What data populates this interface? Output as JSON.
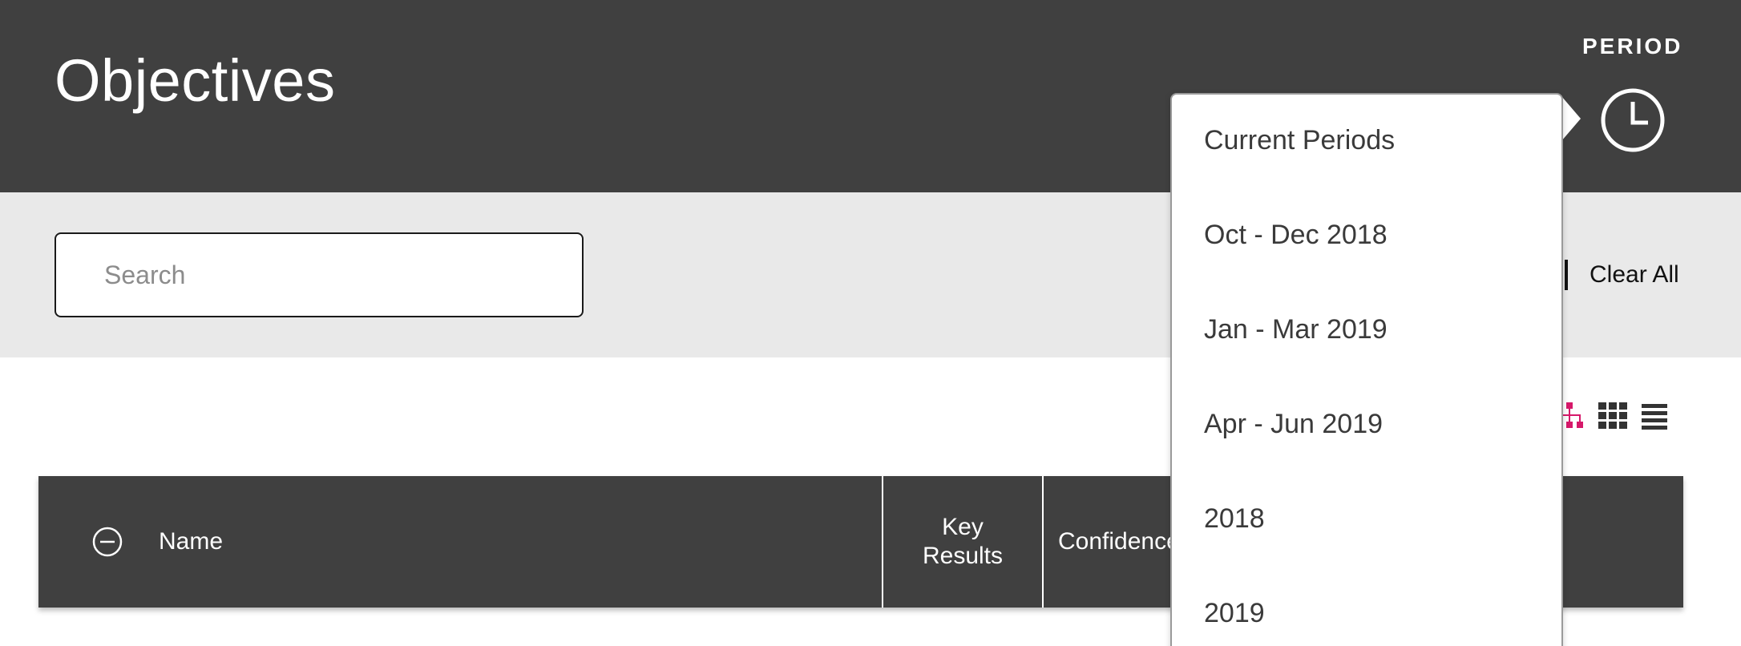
{
  "header": {
    "title": "Objectives",
    "period_label": "PERIOD",
    "period_icon": "clock-icon"
  },
  "filters": {
    "search_placeholder": "Search",
    "clear_all_label": "Clear All"
  },
  "view_toggles": [
    {
      "icon": "hierarchy-icon",
      "active": true,
      "color": "#d6186a"
    },
    {
      "icon": "grid-icon",
      "active": false,
      "color": "#ffffff"
    },
    {
      "icon": "list-icon",
      "active": false,
      "color": "#ffffff"
    }
  ],
  "table": {
    "collapse_icon": "minus-circle-icon",
    "columns": {
      "name": "Name",
      "key_results_line1": "Key",
      "key_results_line2": "Results",
      "confidence": "Confidence"
    }
  },
  "period_dropdown": {
    "items": [
      "Current Periods",
      "Oct - Dec 2018",
      "Jan - Mar 2019",
      "Apr - Jun 2019",
      "2018",
      "2019"
    ]
  },
  "colors": {
    "header_bg": "#404040",
    "filter_bg": "#e9e9e9",
    "accent": "#d6186a"
  }
}
